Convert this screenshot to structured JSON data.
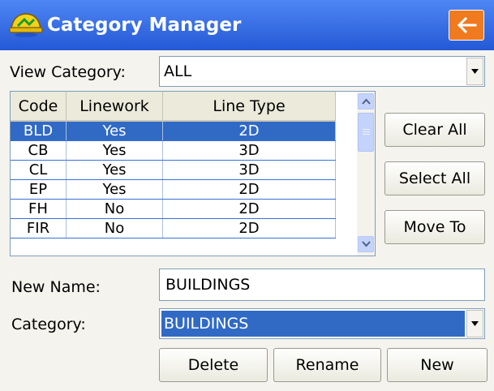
{
  "titlebar": {
    "title": "Category Manager"
  },
  "view": {
    "label": "View Category:",
    "value": "ALL"
  },
  "table": {
    "headers": [
      "Code",
      "Linework",
      "Line Type"
    ],
    "rows": [
      [
        "BLD",
        "Yes",
        "2D"
      ],
      [
        "CB",
        "Yes",
        "3D"
      ],
      [
        "CL",
        "Yes",
        "3D"
      ],
      [
        "EP",
        "Yes",
        "2D"
      ],
      [
        "FH",
        "No",
        "2D"
      ],
      [
        "FIR",
        "No",
        "2D"
      ]
    ],
    "selected_row": 0
  },
  "side_buttons": {
    "clear_all": "Clear All",
    "select_all": "Select All",
    "move_to": "Move To"
  },
  "form": {
    "new_name_label": "New Name:",
    "new_name_value": "BUILDINGS",
    "category_label": "Category:",
    "category_value": "BUILDINGS"
  },
  "bottom_buttons": {
    "delete": "Delete",
    "rename": "Rename",
    "new": "New"
  },
  "colors": {
    "titlebar": "#2b62e0",
    "accent": "#f07a1f",
    "selection": "#316ac5"
  }
}
